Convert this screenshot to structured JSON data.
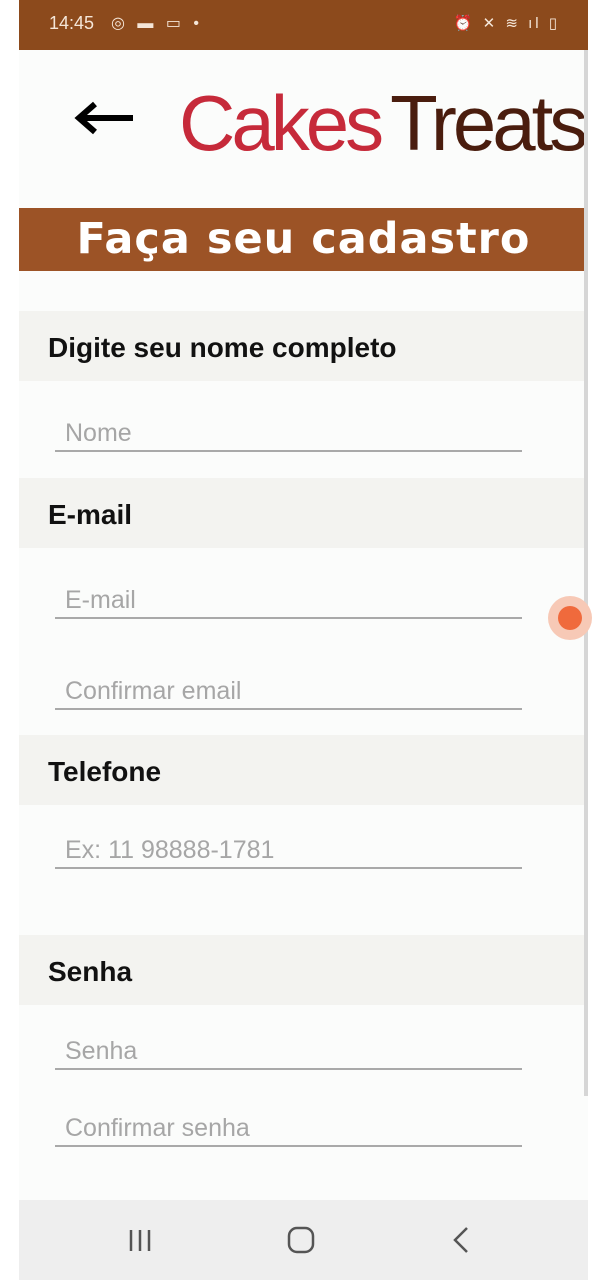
{
  "status_bar": {
    "time": "14:45",
    "left_icons": "◎ ▬ ▭ •",
    "right_icons": "⏰ ✕ ≋ ıl ▯"
  },
  "header": {
    "back_icon": "back-arrow-icon",
    "logo_part1": "Cakes",
    "logo_part2": "Treats",
    "logo_colors": {
      "cakes": "#c62a3a",
      "treats": "#4a1d0e"
    }
  },
  "banner": {
    "title": "Faça seu cadastro",
    "color": "#9c5326"
  },
  "sections": {
    "name": {
      "label": "Digite seu nome completo",
      "placeholder": "Nome"
    },
    "email": {
      "label": "E-mail",
      "placeholder": "E-mail",
      "confirm_placeholder": "Confirmar email"
    },
    "phone": {
      "label": "Telefone",
      "placeholder": "Ex: 11 98888-1781"
    },
    "password": {
      "label": "Senha",
      "placeholder": "Senha",
      "confirm_placeholder": "Confirmar senha"
    }
  },
  "nav_bar": {
    "recents": "recents-icon",
    "home": "home-icon",
    "back": "back-icon"
  }
}
